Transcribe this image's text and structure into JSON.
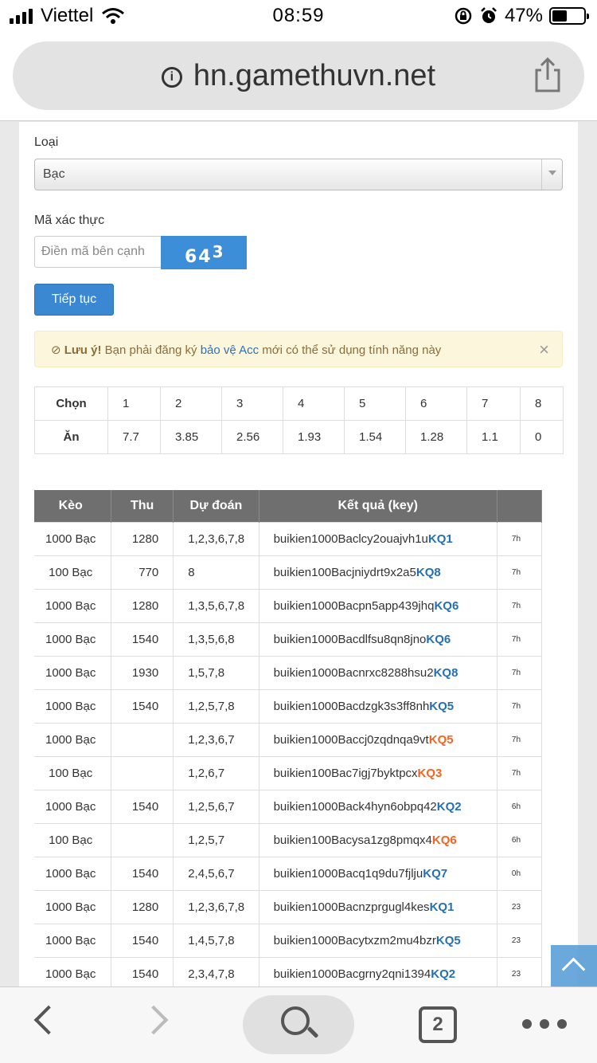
{
  "status": {
    "carrier": "Viettel",
    "time": "08:59",
    "battery": "47%",
    "battery_level": 0.47
  },
  "browser": {
    "url": "hn.gamethuvn.net",
    "tabs_count": "2"
  },
  "form": {
    "type_label": "Loại",
    "type_value": "Bạc",
    "captcha_label": "Mã xác thực",
    "captcha_placeholder": "Điền mã bên cạnh",
    "captcha_code_main": "64",
    "captcha_code_sup": "3",
    "continue_label": "Tiếp tục"
  },
  "alert": {
    "title": "Lưu ý!",
    "text_before": " Bạn phải đăng ký ",
    "link": "bảo vệ Acc",
    "text_after": " mới có thể sử dụng tính năng này",
    "close": "×"
  },
  "odds": {
    "choose_label": "Chọn",
    "win_label": "Ăn",
    "choices": [
      "1",
      "2",
      "3",
      "4",
      "5",
      "6",
      "7",
      "8"
    ],
    "payouts": [
      "7.7",
      "3.85",
      "2.56",
      "1.93",
      "1.54",
      "1.28",
      "1.1",
      "0"
    ]
  },
  "history": {
    "headers": {
      "keo": "Kèo",
      "thu": "Thu",
      "du_doan": "Dự đoán",
      "ket_qua": "Kết quả (key)"
    },
    "rows": [
      {
        "stt": "7",
        "keo": "1000 Bạc",
        "thu": "1280",
        "dd": "1,2,3,6,7,8",
        "key": "buikien1000Baclcy2ouajvh1u",
        "kq": "KQ1",
        "hl": "b",
        "tm": "7h"
      },
      {
        "stt": "2",
        "keo": "100 Bạc",
        "thu": "770",
        "dd": "8",
        "key": "buikien100Bacjniydrt9x2a5",
        "kq": "KQ8",
        "hl": "b",
        "tm": "7h"
      },
      {
        "stt": "1",
        "keo": "1000 Bạc",
        "thu": "1280",
        "dd": "1,3,5,6,7,8",
        "key": "buikien1000Bacpn5app439jhq",
        "kq": "KQ6",
        "hl": "b",
        "tm": "7h"
      },
      {
        "stt": "3",
        "keo": "1000 Bạc",
        "thu": "1540",
        "dd": "1,3,5,6,8",
        "key": "buikien1000Bacdlfsu8qn8jno",
        "kq": "KQ6",
        "hl": "b",
        "tm": "7h"
      },
      {
        "stt": "2",
        "keo": "1000 Bạc",
        "thu": "1930",
        "dd": "1,5,7,8",
        "key": "buikien1000Bacnrxc8288hsu2",
        "kq": "KQ8",
        "hl": "b",
        "tm": "7h"
      },
      {
        "stt": "1",
        "keo": "1000 Bạc",
        "thu": "1540",
        "dd": "1,2,5,7,8",
        "key": "buikien1000Bacdzgk3s3ff8nh",
        "kq": "KQ5",
        "hl": "b",
        "tm": "7h"
      },
      {
        "stt": "9",
        "keo": "1000 Bạc",
        "thu": "",
        "dd": "1,2,3,6,7",
        "key": "buikien1000Baccj0zqdnqa9vt",
        "kq": "KQ5",
        "hl": "o",
        "tm": "7h"
      },
      {
        "stt": "3",
        "keo": "100 Bạc",
        "thu": "",
        "dd": "1,2,6,7",
        "key": "buikien100Bac7igj7byktpcx",
        "kq": "KQ3",
        "hl": "o",
        "tm": "7h"
      },
      {
        "stt": "7",
        "keo": "1000 Bạc",
        "thu": "1540",
        "dd": "1,2,5,6,7",
        "key": "buikien1000Back4hyn6obpq42",
        "kq": "KQ2",
        "hl": "b",
        "tm": "6h"
      },
      {
        "stt": "5",
        "keo": "100 Bạc",
        "thu": "",
        "dd": "1,2,5,7",
        "key": "buikien100Bacysa1zg8pmqx4",
        "kq": "KQ6",
        "hl": "o",
        "tm": "6h"
      },
      {
        "stt": "0",
        "keo": "1000 Bạc",
        "thu": "1540",
        "dd": "2,4,5,6,7",
        "key": "buikien1000Bacq1q9du7fjlju",
        "kq": "KQ7",
        "hl": "b",
        "tm": "0h"
      },
      {
        "stt": "5",
        "keo": "1000 Bạc",
        "thu": "1280",
        "dd": "1,2,3,6,7,8",
        "key": "buikien1000Bacnzprgugl4kes",
        "kq": "KQ1",
        "hl": "b",
        "tm": "23"
      },
      {
        "stt": "4",
        "keo": "1000 Bạc",
        "thu": "1540",
        "dd": "1,4,5,7,8",
        "key": "buikien1000Bacytxzm2mu4bzr",
        "kq": "KQ5",
        "hl": "b",
        "tm": "23"
      },
      {
        "stt": "1",
        "keo": "1000 Bạc",
        "thu": "1540",
        "dd": "2,3,4,7,8",
        "key": "buikien1000Bacgrny2qni1394",
        "kq": "KQ2",
        "hl": "b",
        "tm": "23"
      }
    ]
  },
  "colors": {
    "primary": "#3a87d2",
    "key_blue": "#2570b5",
    "key_orange": "#f26522",
    "table_header": "#6f6f6f",
    "alert_bg": "#fcf7dc"
  }
}
